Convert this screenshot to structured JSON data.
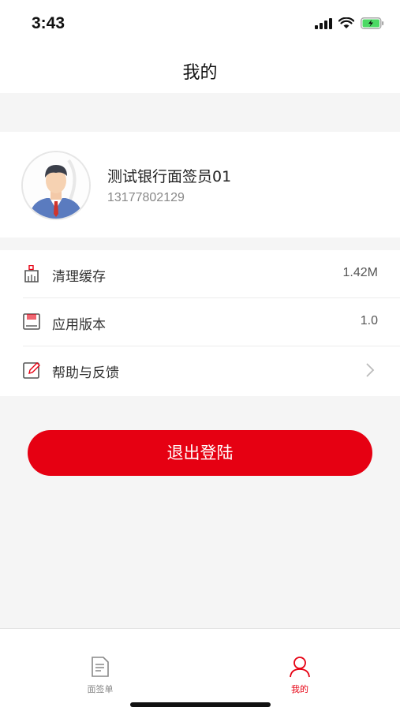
{
  "status_bar": {
    "time": "3:43"
  },
  "header": {
    "title": "我的"
  },
  "profile": {
    "name": "测试银行面签员01",
    "phone": "13177802129"
  },
  "menu": {
    "items": [
      {
        "label": "清理缓存",
        "value": "1.42M",
        "icon": "broom-icon"
      },
      {
        "label": "应用版本",
        "value": "1.0",
        "icon": "version-icon"
      },
      {
        "label": "帮助与反馈",
        "value": "",
        "icon": "edit-feedback-icon"
      }
    ]
  },
  "logout": {
    "label": "退出登陆"
  },
  "tabbar": {
    "tabs": [
      {
        "label": "面签单",
        "icon": "document-icon",
        "active": false
      },
      {
        "label": "我的",
        "icon": "user-icon",
        "active": true
      }
    ]
  },
  "colors": {
    "accent": "#e60012",
    "text": "#333333",
    "muted": "#888888",
    "background": "#f5f5f5"
  }
}
